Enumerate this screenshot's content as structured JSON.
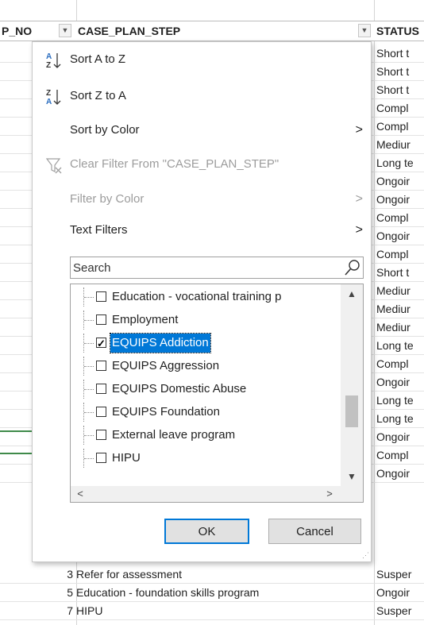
{
  "header": {
    "col_no": "P_NO",
    "col_step": "CASE_PLAN_STEP",
    "col_status": "STATUS"
  },
  "status_column": [
    "Short t",
    "Short t",
    "Short t",
    "Compl",
    "Compl",
    "Mediur",
    "Long te",
    "Ongoir",
    "Ongoir",
    "Compl",
    "Ongoir",
    "Compl",
    "Short t",
    "Mediur",
    "Mediur",
    "Mediur",
    "Long te",
    "Compl",
    "Ongoir",
    "Long te",
    "Long te",
    "Ongoir",
    "Compl",
    "Ongoir"
  ],
  "bottom_rows": [
    {
      "no": "3",
      "step": "Refer for assessment",
      "status": "Susper"
    },
    {
      "no": "5",
      "step": "Education - foundation skills program",
      "status": "Ongoir"
    },
    {
      "no": "7",
      "step": "HIPU",
      "status": "Susper"
    }
  ],
  "menu": {
    "sort_a_z": "Sort A to Z",
    "sort_z_a": "Sort Z to A",
    "sort_by_color": "Sort by Color",
    "clear_filter": "Clear Filter From \"CASE_PLAN_STEP\"",
    "filter_by_color": "Filter by Color",
    "text_filters": "Text Filters"
  },
  "search": {
    "placeholder": "Search"
  },
  "filter_list": [
    {
      "label": "Education - vocational training p",
      "checked": false,
      "selected": false
    },
    {
      "label": "Employment",
      "checked": false,
      "selected": false
    },
    {
      "label": "EQUIPS Addiction",
      "checked": true,
      "selected": true
    },
    {
      "label": "EQUIPS Aggression",
      "checked": false,
      "selected": false
    },
    {
      "label": "EQUIPS Domestic Abuse",
      "checked": false,
      "selected": false
    },
    {
      "label": "EQUIPS Foundation",
      "checked": false,
      "selected": false
    },
    {
      "label": "External leave program",
      "checked": false,
      "selected": false
    },
    {
      "label": "HIPU",
      "checked": false,
      "selected": false
    }
  ],
  "buttons": {
    "ok": "OK",
    "cancel": "Cancel"
  },
  "icons": {
    "sort_asc": "sort-ascending-icon",
    "sort_desc": "sort-descending-icon",
    "clear_filter": "clear-filter-icon",
    "search": "search-icon"
  }
}
